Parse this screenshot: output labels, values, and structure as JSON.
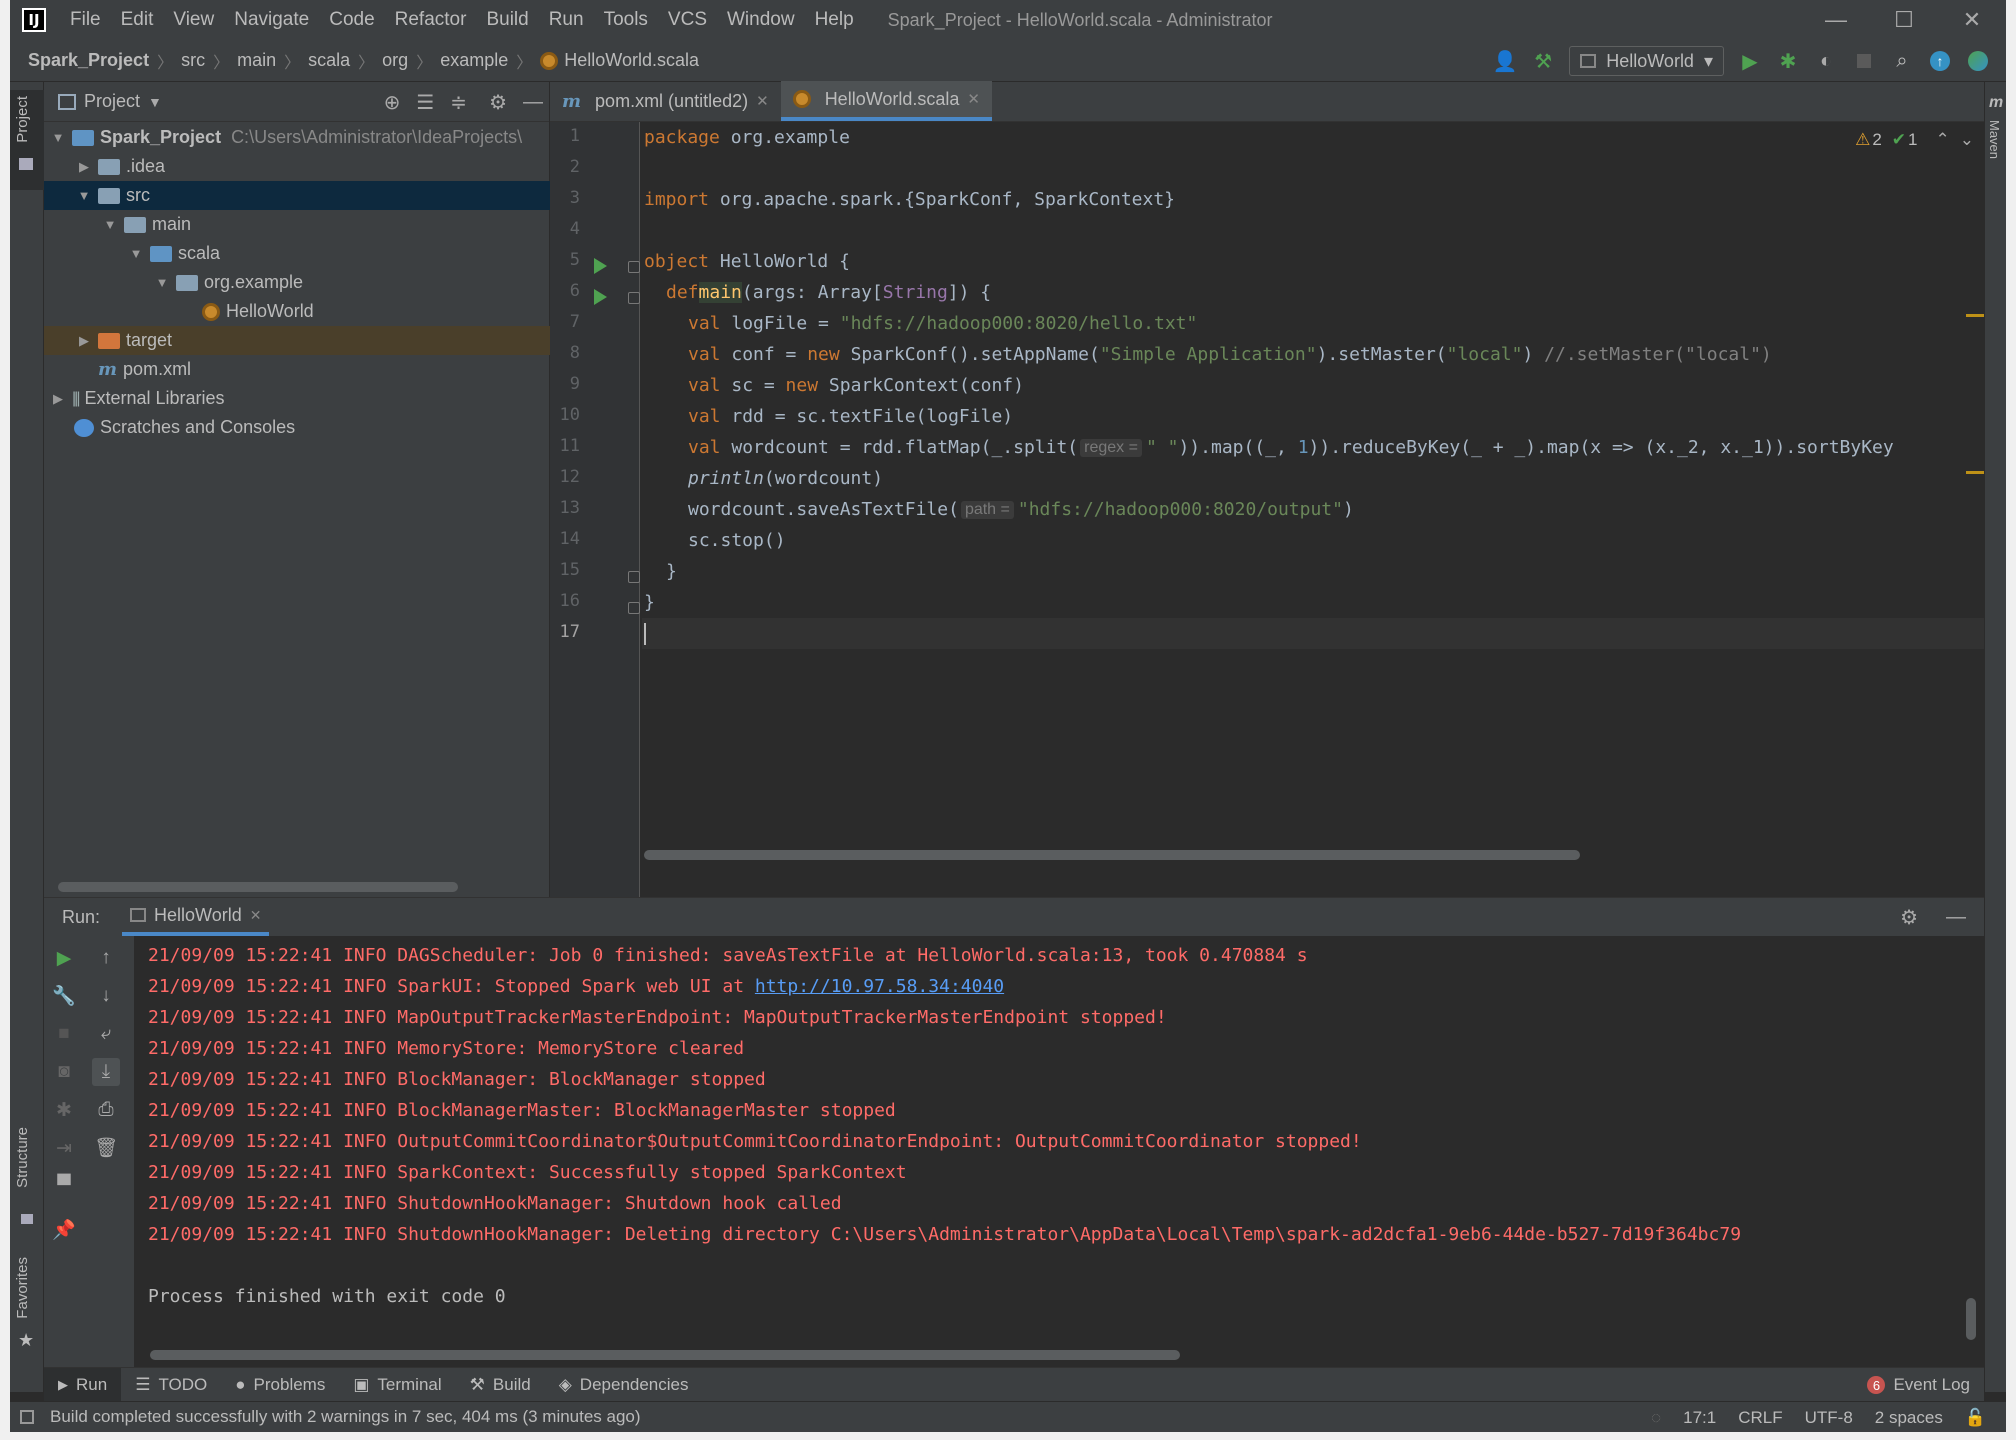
{
  "window": {
    "title": "Spark_Project - HelloWorld.scala - Administrator",
    "logo": "IJ",
    "menu": [
      "File",
      "Edit",
      "View",
      "Navigate",
      "Code",
      "Refactor",
      "Build",
      "Run",
      "Tools",
      "VCS",
      "Window",
      "Help"
    ],
    "controls": {
      "minimize": "—",
      "maximize": "☐",
      "close": "✕"
    }
  },
  "breadcrumb": [
    "Spark_Project",
    "src",
    "main",
    "scala",
    "org",
    "example",
    "HelloWorld.scala"
  ],
  "run_config": {
    "name": "HelloWorld",
    "caret": "▾"
  },
  "left_strip": {
    "project": "Project",
    "structure": "Structure",
    "favorites": "Favorites"
  },
  "right_strip": {
    "maven": "Maven"
  },
  "project_panel": {
    "title": "Project",
    "tree": [
      {
        "label": "Spark_Project",
        "extra": "C:\\Users\\Administrator\\IdeaProjects\\",
        "arrow": "▼",
        "type": "module"
      },
      {
        "label": ".idea",
        "arrow": "▶",
        "type": "folder"
      },
      {
        "label": "src",
        "arrow": "▼",
        "type": "folder"
      },
      {
        "label": "main",
        "arrow": "▼",
        "type": "folder"
      },
      {
        "label": "scala",
        "arrow": "▼",
        "type": "folder-blue"
      },
      {
        "label": "org.example",
        "arrow": "▼",
        "type": "package"
      },
      {
        "label": "HelloWorld",
        "arrow": "",
        "type": "scala"
      },
      {
        "label": "target",
        "arrow": "▶",
        "type": "folder-orange"
      },
      {
        "label": "pom.xml",
        "arrow": "",
        "type": "maven"
      },
      {
        "label": "External Libraries",
        "arrow": "▶",
        "type": "library"
      },
      {
        "label": "Scratches and Consoles",
        "arrow": "",
        "type": "scratch"
      }
    ]
  },
  "editor": {
    "tabs": [
      {
        "label": "pom.xml (untitled2)",
        "close": "✕",
        "active": false
      },
      {
        "label": "HelloWorld.scala",
        "close": "✕",
        "active": true
      }
    ],
    "inspections": {
      "warnings": "2",
      "weak": "1"
    },
    "line_numbers": [
      "1",
      "2",
      "3",
      "4",
      "5",
      "6",
      "7",
      "8",
      "9",
      "10",
      "11",
      "12",
      "13",
      "14",
      "15",
      "16",
      "17"
    ],
    "code": {
      "l1_kw": "package",
      "l1_rest": " org.example",
      "l3_kw": "import",
      "l3_rest": " org.apache.spark.{SparkConf, SparkContext}",
      "l5_kw": "object",
      "l5_rest": " HelloWorld {",
      "l6_kw": "def",
      "l6_name": "main",
      "l6_a": "(args: Array[",
      "l6_type": "String",
      "l6_b": "]) {",
      "l7_kw": "val",
      "l7_a": " logFile = ",
      "l7_str": "\"hdfs://hadoop000:8020/hello.txt\"",
      "l8_kw": "val",
      "l8_a": " conf = ",
      "l8_kw2": "new",
      "l8_b": " SparkConf().setAppName(",
      "l8_str1": "\"Simple Application\"",
      "l8_c": ").setMaster(",
      "l8_str2": "\"local\"",
      "l8_d": ") ",
      "l8_cm": "//.setMaster(\"local\")",
      "l9_kw": "val",
      "l9_a": " sc = ",
      "l9_kw2": "new",
      "l9_b": " SparkContext(conf)",
      "l10_kw": "val",
      "l10_a": " rdd = sc.textFile(logFile)",
      "l11_kw": "val",
      "l11_a": " wordcount = rdd.flatMap(_.split(",
      "l11_hint": "regex =",
      "l11_str": "\" \"",
      "l11_b": ")).map((_, ",
      "l11_num": "1",
      "l11_c": ")).reduceByKey(_ + _).map(x => (x._2, x._1)).sortByKey",
      "l12_it": "println",
      "l12_rest": "(wordcount)",
      "l13_a": "wordcount.saveAsTextFile(",
      "l13_hint": "path =",
      "l13_str": "\"hdfs://hadoop000:8020/output\"",
      "l13_b": ")",
      "l14": "sc.stop()",
      "l15": "}",
      "l16": "}"
    }
  },
  "run_panel": {
    "label": "Run:",
    "tab": "HelloWorld",
    "close": "✕",
    "log": [
      "21/09/09 15:22:41 INFO DAGScheduler: Job 0 finished: saveAsTextFile at HelloWorld.scala:13, took 0.470884 s",
      "21/09/09 15:22:41 INFO SparkUI: Stopped Spark web UI at ",
      "21/09/09 15:22:41 INFO MapOutputTrackerMasterEndpoint: MapOutputTrackerMasterEndpoint stopped!",
      "21/09/09 15:22:41 INFO MemoryStore: MemoryStore cleared",
      "21/09/09 15:22:41 INFO BlockManager: BlockManager stopped",
      "21/09/09 15:22:41 INFO BlockManagerMaster: BlockManagerMaster stopped",
      "21/09/09 15:22:41 INFO OutputCommitCoordinator$OutputCommitCoordinatorEndpoint: OutputCommitCoordinator stopped!",
      "21/09/09 15:22:41 INFO SparkContext: Successfully stopped SparkContext",
      "21/09/09 15:22:41 INFO ShutdownHookManager: Shutdown hook called",
      "21/09/09 15:22:41 INFO ShutdownHookManager: Deleting directory C:\\Users\\Administrator\\AppData\\Local\\Temp\\spark-ad2dcfa1-9eb6-44de-b527-7d19f364bc79"
    ],
    "link": "http://10.97.58.34:4040",
    "exit": "Process finished with exit code 0"
  },
  "tool_windows": [
    {
      "label": "Run",
      "icon": "▶"
    },
    {
      "label": "TODO",
      "icon": "☰"
    },
    {
      "label": "Problems",
      "icon": "●"
    },
    {
      "label": "Terminal",
      "icon": "▣"
    },
    {
      "label": "Build",
      "icon": "⚒"
    },
    {
      "label": "Dependencies",
      "icon": "◈"
    }
  ],
  "event_log": {
    "count": "6",
    "label": "Event Log"
  },
  "status": {
    "message": "Build completed successfully with 2 warnings in 7 sec, 404 ms (3 minutes ago)",
    "position": "17:1",
    "line_sep": "CRLF",
    "encoding": "UTF-8",
    "indent": "2 spaces"
  },
  "colors": {
    "accent": "#4a88c7",
    "run_green": "#4fa251",
    "log_red": "#ff6b68",
    "selection": "#0d293e"
  }
}
